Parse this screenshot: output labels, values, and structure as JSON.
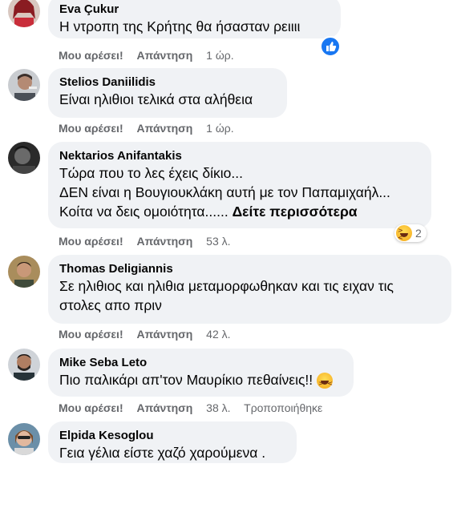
{
  "comments": [
    {
      "author": "Eva Çukur",
      "lines": [
        "Η ντροπη της Κρήτης θα ήσασταν ρειιιι"
      ],
      "like_label": "Μου αρέσει!",
      "reply_label": "Απάντηση",
      "time": "1 ώρ.",
      "reaction_icon": "like-icon"
    },
    {
      "author": "Stelios Daniilidis",
      "lines": [
        "Είναι ηλιθιοι τελικά στα αλήθεια"
      ],
      "like_label": "Μου αρέσει!",
      "reply_label": "Απάντηση",
      "time": "1 ώρ."
    },
    {
      "author": "Nektarios Anifantakis",
      "lines": [
        "Τώρα που το λες έχεις δίκιο...",
        "ΔΕΝ είναι η Βουγιουκλάκη αυτή με τον Παπαμιχαήλ...",
        "Κοίτα να δεις ομοιότητα......"
      ],
      "see_more": "Δείτε περισσότερα",
      "like_label": "Μου αρέσει!",
      "reply_label": "Απάντηση",
      "time": "53 λ.",
      "reaction_icon": "laugh-icon",
      "reaction_count": "2"
    },
    {
      "author": "Thomas Deligiannis",
      "lines": [
        "Σε ηλιθιος και ηλιθια μεταμορφωθηκαν και τις ειχαν τις",
        "στολες απο πριν"
      ],
      "like_label": "Μου αρέσει!",
      "reply_label": "Απάντηση",
      "time": "42 λ."
    },
    {
      "author": "Mike Seba Leto",
      "lines": [
        "Πιο παλικάρι απ'τον Μαυρίκιο πεθαίνεις!!"
      ],
      "inline_emoji": "laugh-icon",
      "like_label": "Μου αρέσει!",
      "reply_label": "Απάντηση",
      "time": "38 λ.",
      "edited": "Τροποποιήθηκε"
    },
    {
      "author": "Elpida Kesoglou",
      "lines": [
        "Γεια γέλια είστε χαζό χαρούμενα ."
      ]
    }
  ],
  "colors": {
    "bubble": "#f0f2f5",
    "meta_text": "#65676b",
    "like_blue": "#1877f2"
  }
}
